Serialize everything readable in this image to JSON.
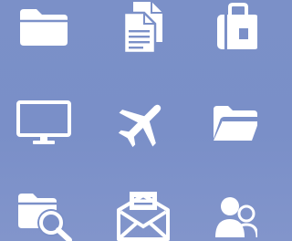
{
  "icon_color": "#ffffff",
  "background": {
    "top_color": "#7b90c8",
    "bottom_color": "#8295cb"
  },
  "icons": [
    {
      "id": "folder",
      "name": "folder-icon"
    },
    {
      "id": "docs",
      "name": "documents-icon"
    },
    {
      "id": "luggage",
      "name": "luggage-icon"
    },
    {
      "id": "monitor",
      "name": "monitor-icon"
    },
    {
      "id": "plane",
      "name": "airplane-icon"
    },
    {
      "id": "openfold",
      "name": "open-folder-icon"
    },
    {
      "id": "search",
      "name": "folder-search-icon"
    },
    {
      "id": "mail",
      "name": "mail-icon"
    },
    {
      "id": "users",
      "name": "users-icon"
    }
  ]
}
